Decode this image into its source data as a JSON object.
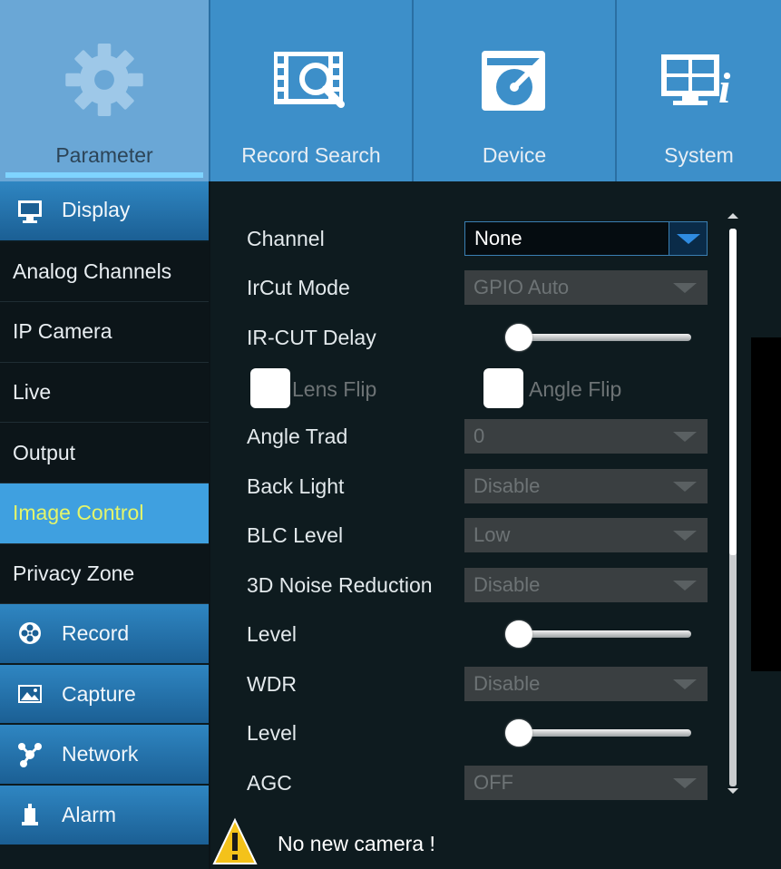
{
  "topnav": {
    "tabs": [
      {
        "label": "Parameter",
        "icon": "gear-icon",
        "active": true
      },
      {
        "label": "Record Search",
        "icon": "film-search-icon",
        "active": false
      },
      {
        "label": "Device",
        "icon": "disk-icon",
        "active": false
      },
      {
        "label": "System",
        "icon": "system-info-icon",
        "active": false
      }
    ]
  },
  "sidebar": {
    "items": [
      {
        "label": "Display",
        "type": "category",
        "icon": "monitor-icon"
      },
      {
        "label": "Analog Channels",
        "type": "sub"
      },
      {
        "label": "IP Camera",
        "type": "sub"
      },
      {
        "label": "Live",
        "type": "sub"
      },
      {
        "label": "Output",
        "type": "sub"
      },
      {
        "label": "Image Control",
        "type": "sub",
        "selected": true
      },
      {
        "label": "Privacy Zone",
        "type": "sub"
      },
      {
        "label": "Record",
        "type": "category",
        "icon": "film-reel-icon"
      },
      {
        "label": "Capture",
        "type": "category",
        "icon": "picture-icon"
      },
      {
        "label": "Network",
        "type": "category",
        "icon": "network-icon"
      },
      {
        "label": "Alarm",
        "type": "category",
        "icon": "alarm-icon"
      }
    ]
  },
  "form": {
    "channel": {
      "label": "Channel",
      "value": "None"
    },
    "ircut_mode": {
      "label": "IrCut Mode",
      "value": "GPIO Auto"
    },
    "ircut_delay": {
      "label": "IR-CUT Delay",
      "level": 0
    },
    "lens_flip": {
      "label": "Lens Flip",
      "checked": false
    },
    "angle_flip": {
      "label": "Angle Flip",
      "checked": false
    },
    "angle_trad": {
      "label": "Angle Trad",
      "value": "0"
    },
    "back_light": {
      "label": "Back Light",
      "value": "Disable"
    },
    "blc_level": {
      "label": "BLC Level",
      "value": "Low"
    },
    "noise_reduction": {
      "label": "3D Noise Reduction",
      "value": "Disable"
    },
    "nr_level": {
      "label": "Level",
      "level": 0
    },
    "wdr": {
      "label": "WDR",
      "value": "Disable"
    },
    "wdr_level": {
      "label": "Level",
      "level": 0
    },
    "agc": {
      "label": "AGC",
      "value": "OFF"
    }
  },
  "status": {
    "message": "No new camera !",
    "icon": "warning-icon"
  },
  "colors": {
    "nav_bg": "#3d8fc9",
    "selected_bg": "#3fa0e0",
    "selected_text": "#e4f56a",
    "content_bg": "#0e1b1f"
  }
}
